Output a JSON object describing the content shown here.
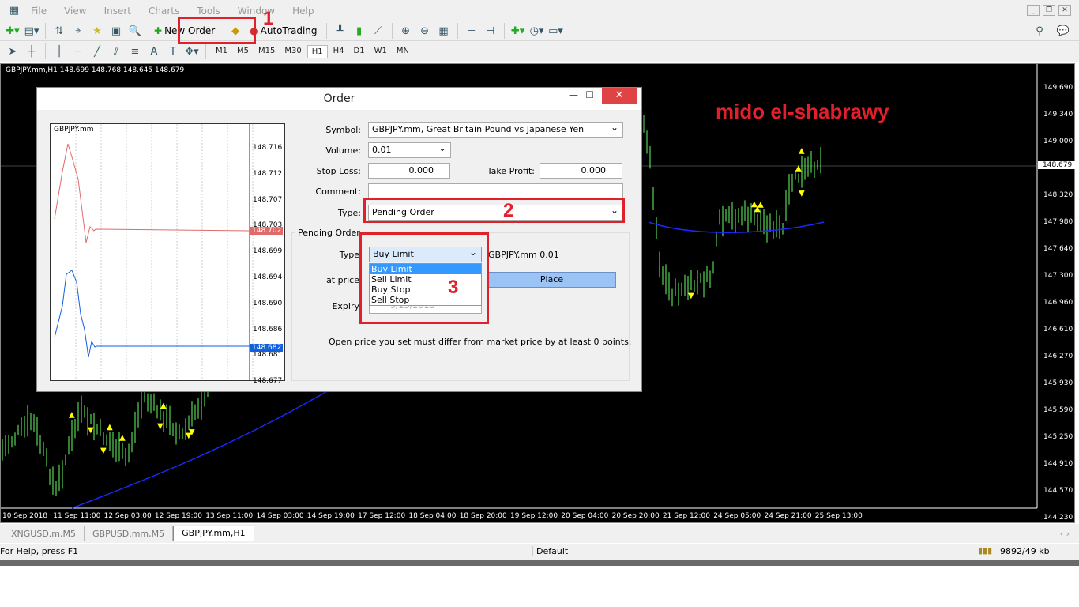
{
  "menu": [
    "File",
    "View",
    "Insert",
    "Charts",
    "Tools",
    "Window",
    "Help"
  ],
  "toolbar": {
    "new_order": "New Order",
    "autotrading": "AutoTrading"
  },
  "timeframes": [
    "M1",
    "M5",
    "M15",
    "M30",
    "H1",
    "H4",
    "D1",
    "W1",
    "MN"
  ],
  "active_timeframe": "H1",
  "chart": {
    "info": "GBPJPY.mm,H1  148.699 148.768 148.645 148.679",
    "current_price": "148.679",
    "price_labels": [
      "149.690",
      "149.340",
      "149.000",
      "148.320",
      "147.980",
      "147.640",
      "147.300",
      "146.960",
      "146.610",
      "146.270",
      "145.930",
      "145.590",
      "145.250",
      "144.910",
      "144.570",
      "144.230"
    ],
    "time_labels": [
      "10 Sep 2018",
      "11 Sep 11:00",
      "12 Sep 03:00",
      "12 Sep 19:00",
      "13 Sep 11:00",
      "14 Sep 03:00",
      "14 Sep 19:00",
      "17 Sep 12:00",
      "18 Sep 04:00",
      "18 Sep 20:00",
      "19 Sep 12:00",
      "20 Sep 04:00",
      "20 Sep 20:00",
      "21 Sep 12:00",
      "24 Sep 05:00",
      "24 Sep 21:00",
      "25 Sep 13:00"
    ],
    "watermark": "mido el-shabrawy"
  },
  "annotations": [
    "1",
    "2",
    "3"
  ],
  "tabs": [
    "XNGUSD.m,M5",
    "GBPUSD.mm,M5",
    "GBPJPY.mm,H1"
  ],
  "active_tab": "GBPJPY.mm,H1",
  "status": {
    "help": "For Help, press F1",
    "profile": "Default",
    "traffic": "9892/49 kb"
  },
  "order": {
    "title": "Order",
    "symbol_label": "Symbol:",
    "symbol": "GBPJPY.mm, Great Britain Pound vs Japanese Yen",
    "volume_label": "Volume:",
    "volume": "0.01",
    "sl_label": "Stop Loss:",
    "sl": "0.000",
    "tp_label": "Take Profit:",
    "tp": "0.000",
    "comment_label": "Comment:",
    "comment": "",
    "type_label": "Type:",
    "type": "Pending Order",
    "pending": {
      "group": "Pending Order",
      "type_label": "Type",
      "type": "Buy Limit",
      "options": [
        "Buy Limit",
        "Sell Limit",
        "Buy Stop",
        "Sell Stop"
      ],
      "summary": "GBPJPY.mm 0.01",
      "price_label": "at price",
      "place": "Place",
      "expiry_label": "Expiry",
      "expiry": "9/25/2018",
      "note": "Open price you set must differ from market price by at least 0 points."
    },
    "mini_chart": {
      "symbol": "GBPJPY.mm",
      "prices": [
        "148.716",
        "148.712",
        "148.707",
        "148.703",
        "148.699",
        "148.694",
        "148.690",
        "148.686",
        "148.681",
        "148.677"
      ],
      "bid": "148.702",
      "ask": "148.682"
    }
  }
}
